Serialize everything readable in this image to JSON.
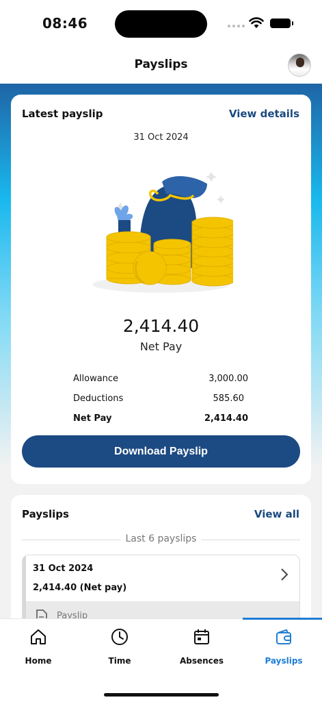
{
  "status_bar": {
    "time": "08:46"
  },
  "header": {
    "title": "Payslips"
  },
  "latest": {
    "title": "Latest payslip",
    "view_details": "View details",
    "date": "31 Oct 2024",
    "net_amount": "2,414.40",
    "net_label": "Net Pay",
    "rows": [
      {
        "label": "Allowance",
        "value": "3,000.00"
      },
      {
        "label": "Deductions",
        "value": "585.60"
      },
      {
        "label": "Net Pay",
        "value": "2,414.40"
      }
    ],
    "download_label": "Download Payslip"
  },
  "payslips": {
    "title": "Payslips",
    "view_all": "View all",
    "subtitle": "Last 6 payslips",
    "items": [
      {
        "date": "31 Oct 2024",
        "amount": "2,414.40 (Net pay)",
        "footer": "Payslip"
      }
    ]
  },
  "tabs": [
    {
      "label": "Home",
      "icon": "home-icon"
    },
    {
      "label": "Time",
      "icon": "clock-icon"
    },
    {
      "label": "Absences",
      "icon": "calendar-icon"
    },
    {
      "label": "Payslips",
      "icon": "wallet-icon",
      "active": true
    }
  ],
  "colors": {
    "accent": "#1f7ed6",
    "primary": "#1c4a82",
    "coin": "#f5c400"
  }
}
